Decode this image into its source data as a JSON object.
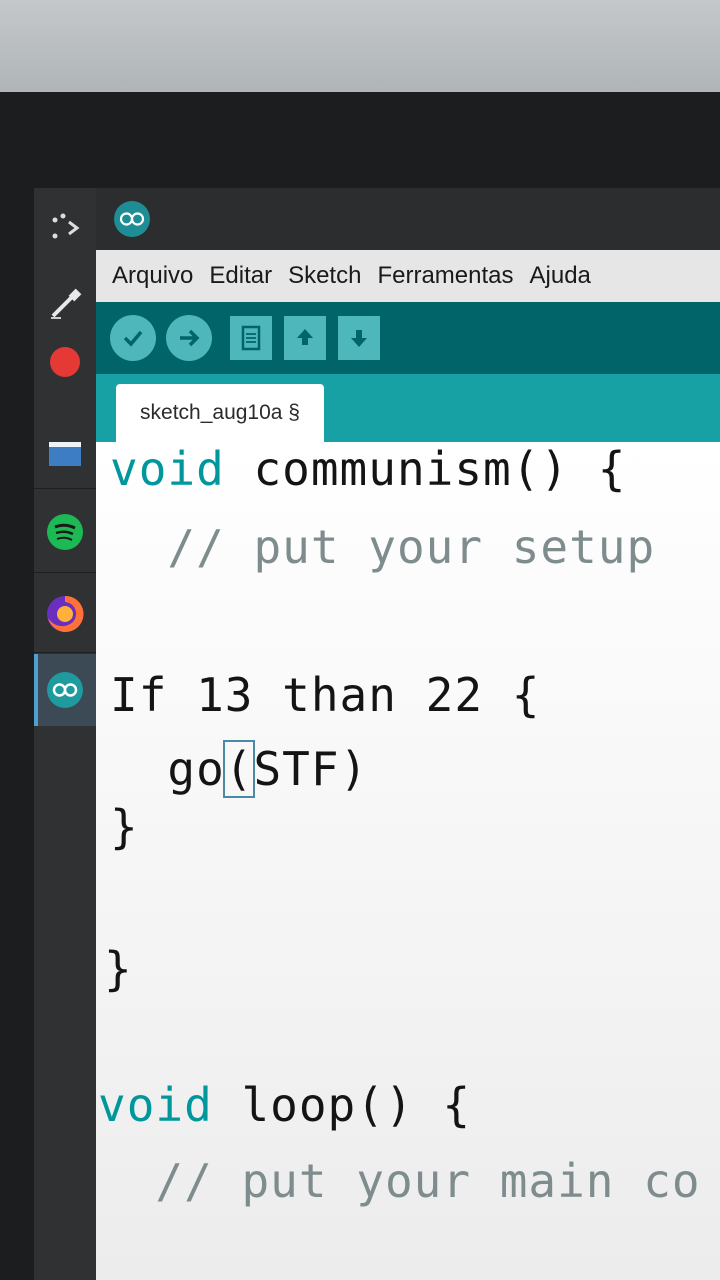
{
  "menu": {
    "items": [
      "Arquivo",
      "Editar",
      "Sketch",
      "Ferramentas",
      "Ajuda"
    ]
  },
  "toolbar": {
    "buttons": [
      "verify-icon",
      "upload-icon",
      "new-icon",
      "open-icon",
      "save-icon"
    ]
  },
  "tab": {
    "label": "sketch_aug10a §"
  },
  "dock": {
    "items": [
      "launcher-icon",
      "color-picker-icon",
      "record-icon",
      "files-icon",
      "spotify-icon",
      "firefox-icon",
      "arduino-icon"
    ]
  },
  "code": {
    "line1_kw": "void",
    "line1_rest": " communism() {",
    "line2": "  // put your setup",
    "line4": "If 13 than 22 {",
    "line5_pre": "  go",
    "line5_cursor": "(",
    "line5_post": "STF)",
    "line6": "}",
    "line8": "}",
    "line10_kw": "void",
    "line10_rest": " loop() {",
    "line11": "  // put your main co"
  },
  "colors": {
    "accent": "#00979c",
    "toolbar": "#006468",
    "tabbar": "#17a1a5",
    "button": "#4db7bb"
  }
}
